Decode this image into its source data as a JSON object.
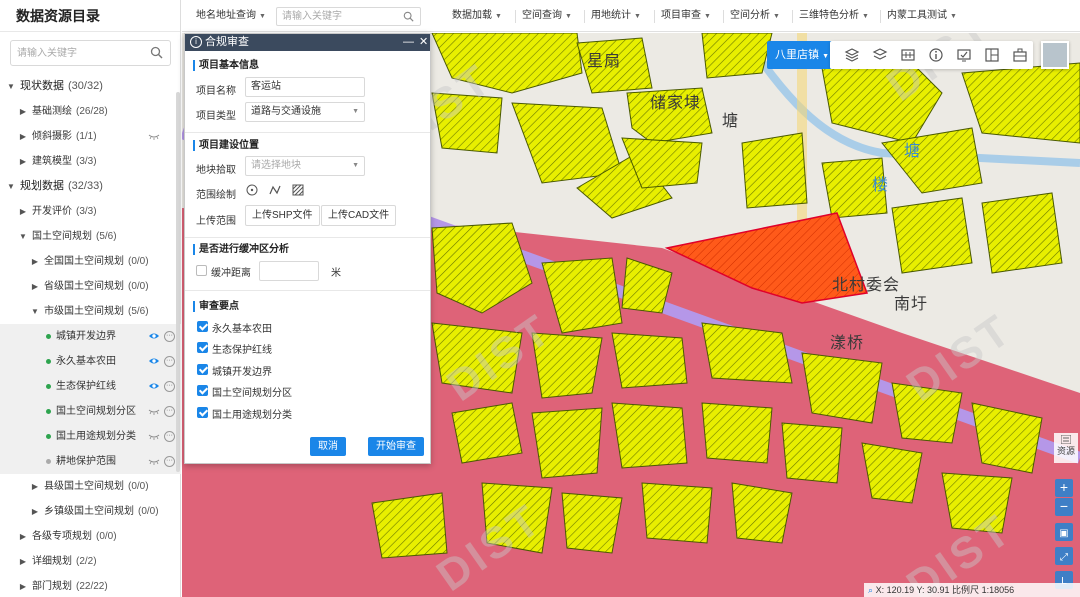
{
  "sidebar": {
    "title": "数据资源目录",
    "search_placeholder": "请输入关键字",
    "tree": [
      {
        "label": "现状数据",
        "count": "(30/32)",
        "level": 0,
        "expanded": true
      },
      {
        "label": "基础测绘",
        "count": "(26/28)",
        "level": 1,
        "expanded": false
      },
      {
        "label": "倾斜摄影",
        "count": "(1/1)",
        "level": 1,
        "expanded": false,
        "eye": "hidden"
      },
      {
        "label": "建筑模型",
        "count": "(3/3)",
        "level": 1,
        "expanded": false
      },
      {
        "label": "规划数据",
        "count": "(32/33)",
        "level": 0,
        "expanded": true
      },
      {
        "label": "开发评价",
        "count": "(3/3)",
        "level": 1,
        "expanded": false
      },
      {
        "label": "国土空间规划",
        "count": "(5/6)",
        "level": 1,
        "expanded": true
      },
      {
        "label": "全国国土空间规划",
        "count": "(0/0)",
        "level": 2,
        "expanded": false
      },
      {
        "label": "省级国土空间规划",
        "count": "(0/0)",
        "level": 2,
        "expanded": false
      },
      {
        "label": "市级国土空间规划",
        "count": "(5/6)",
        "level": 2,
        "expanded": true
      },
      {
        "label": "城镇开发边界",
        "count": "",
        "level": 3,
        "dot": "#2ea44f",
        "eye": "visible",
        "selected": true
      },
      {
        "label": "永久基本农田",
        "count": "",
        "level": 3,
        "dot": "#2ea44f",
        "eye": "visible",
        "selected": true
      },
      {
        "label": "生态保护红线",
        "count": "",
        "level": 3,
        "dot": "#2ea44f",
        "eye": "visible",
        "selected": true
      },
      {
        "label": "国土空间规划分区",
        "count": "",
        "level": 3,
        "dot": "#2ea44f",
        "eye": "hidden",
        "selected": true
      },
      {
        "label": "国土用途规划分类",
        "count": "",
        "level": 3,
        "dot": "#2ea44f",
        "eye": "hidden",
        "selected": true
      },
      {
        "label": "耕地保护范围",
        "count": "",
        "level": 3,
        "dot": "#aaaaaa",
        "eye": "hidden",
        "selected": true
      },
      {
        "label": "县级国土空间规划",
        "count": "(0/0)",
        "level": 2,
        "expanded": false
      },
      {
        "label": "乡镇级国土空间规划",
        "count": "(0/0)",
        "level": 2,
        "expanded": false
      },
      {
        "label": "各级专项规划",
        "count": "(0/0)",
        "level": 1,
        "expanded": false
      },
      {
        "label": "详细规划",
        "count": "(2/2)",
        "level": 1,
        "expanded": false
      },
      {
        "label": "部门规划",
        "count": "(22/22)",
        "level": 1,
        "expanded": false
      }
    ]
  },
  "toolbar": {
    "location_query": "地名地址查询",
    "search_placeholder": "请输入关键字",
    "menus": [
      "数据加载",
      "空间查询",
      "用地统计",
      "项目审查",
      "空间分析",
      "三维特色分析",
      "内蒙工具测试"
    ]
  },
  "map": {
    "town_selector": "八里店镇",
    "labels": [
      "星扇",
      "储家埭",
      "塘",
      "塘",
      "楼",
      "北村委会",
      "南圩",
      "漾桥"
    ],
    "watermark": "DIST",
    "resource_label": "资源",
    "zoom_in": "+",
    "zoom_out": "−",
    "status": {
      "x_label": "X:",
      "x": "120.19",
      "y_label": "Y:",
      "y": "30.91",
      "scale_label": "比例尺",
      "scale": "1:18056"
    },
    "colors": {
      "parcel": "#e8ef00",
      "zone": "#de6378",
      "road": "#b597e8",
      "project": "#ff4d0a"
    }
  },
  "dialog": {
    "title": "合规审查",
    "minimize": "—",
    "close": "✕",
    "basic_info_title": "项目基本信息",
    "project_name_label": "项目名称",
    "project_name_value": "客运站",
    "project_type_label": "项目类型",
    "project_type_value": "道路与交通设施",
    "location_title": "项目建设位置",
    "parcel_pick_label": "地块拾取",
    "parcel_pick_placeholder": "请选择地块",
    "draw_range_label": "范围绘制",
    "upload_range_label": "上传范围",
    "upload_shp": "上传SHP文件",
    "upload_cad": "上传CAD文件",
    "buffer_title": "是否进行缓冲区分析",
    "buffer_label": "缓冲距离",
    "buffer_unit": "米",
    "review_title": "审查要点",
    "review_items": [
      "永久基本农田",
      "生态保护红线",
      "城镇开发边界",
      "国土空间规划分区",
      "国土用途规划分类"
    ],
    "cancel": "取消",
    "start": "开始审查"
  }
}
